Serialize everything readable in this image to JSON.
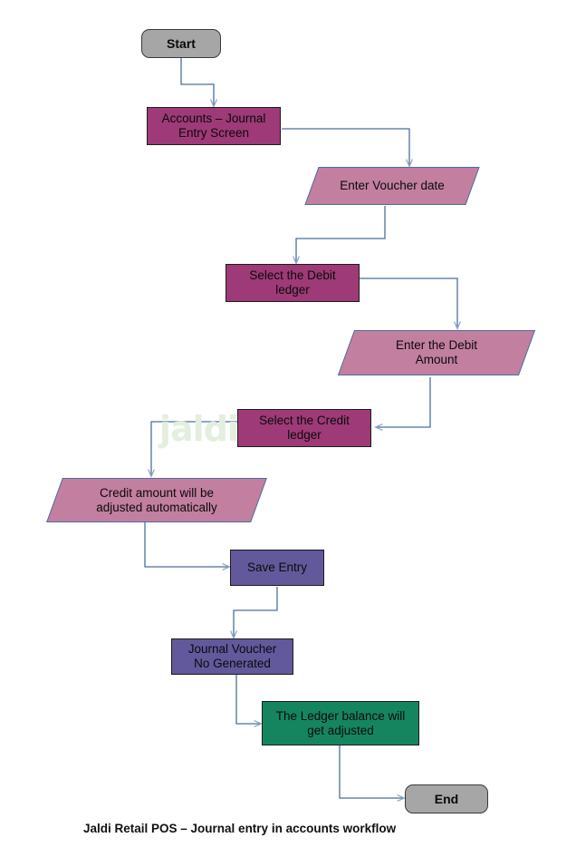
{
  "diagram": {
    "caption": "Jaldi Retail POS – Journal entry in accounts workflow",
    "watermark": "jaldi",
    "colors": {
      "terminator_fill": "#a6a6a6",
      "process_magenta": "#9e3a77",
      "process_purple": "#61599b",
      "process_teal": "#15855f",
      "io_pink": "#c27fa0",
      "connector": "#4a6f9e",
      "arrowhead": "#8fa9c9",
      "watermark_green": "#e4eedf",
      "background": "#ffffff"
    },
    "nodes": [
      {
        "id": "start",
        "label": "Start",
        "shape": "terminator",
        "fill": "#a6a6a6"
      },
      {
        "id": "journal-screen",
        "label": "Accounts – Journal\nEntry Screen",
        "shape": "process",
        "fill": "#9e3a77"
      },
      {
        "id": "voucher-date",
        "label": "Enter Voucher date",
        "shape": "io",
        "fill": "#c27fa0"
      },
      {
        "id": "debit-ledger",
        "label": "Select the Debit\nledger",
        "shape": "process",
        "fill": "#9e3a77"
      },
      {
        "id": "debit-amount",
        "label": "Enter the Debit\nAmount",
        "shape": "io",
        "fill": "#c27fa0"
      },
      {
        "id": "credit-ledger",
        "label": "Select the Credit\nledger",
        "shape": "process",
        "fill": "#9e3a77"
      },
      {
        "id": "credit-amount",
        "label": "Credit amount will be\nadjusted automatically",
        "shape": "io",
        "fill": "#c27fa0"
      },
      {
        "id": "save-entry",
        "label": "Save Entry",
        "shape": "process",
        "fill": "#61599b"
      },
      {
        "id": "journal-voucher",
        "label": "Journal Voucher\nNo Generated",
        "shape": "process",
        "fill": "#61599b"
      },
      {
        "id": "ledger-balance",
        "label": "The Ledger balance will\nget adjusted",
        "shape": "process",
        "fill": "#15855f"
      },
      {
        "id": "end",
        "label": "End",
        "shape": "terminator",
        "fill": "#a6a6a6"
      }
    ],
    "edges": [
      {
        "from": "start",
        "to": "journal-screen"
      },
      {
        "from": "journal-screen",
        "to": "voucher-date"
      },
      {
        "from": "voucher-date",
        "to": "debit-ledger"
      },
      {
        "from": "debit-ledger",
        "to": "debit-amount"
      },
      {
        "from": "debit-amount",
        "to": "credit-ledger"
      },
      {
        "from": "credit-ledger",
        "to": "credit-amount"
      },
      {
        "from": "credit-amount",
        "to": "save-entry"
      },
      {
        "from": "save-entry",
        "to": "journal-voucher"
      },
      {
        "from": "journal-voucher",
        "to": "ledger-balance"
      },
      {
        "from": "ledger-balance",
        "to": "end"
      }
    ]
  }
}
